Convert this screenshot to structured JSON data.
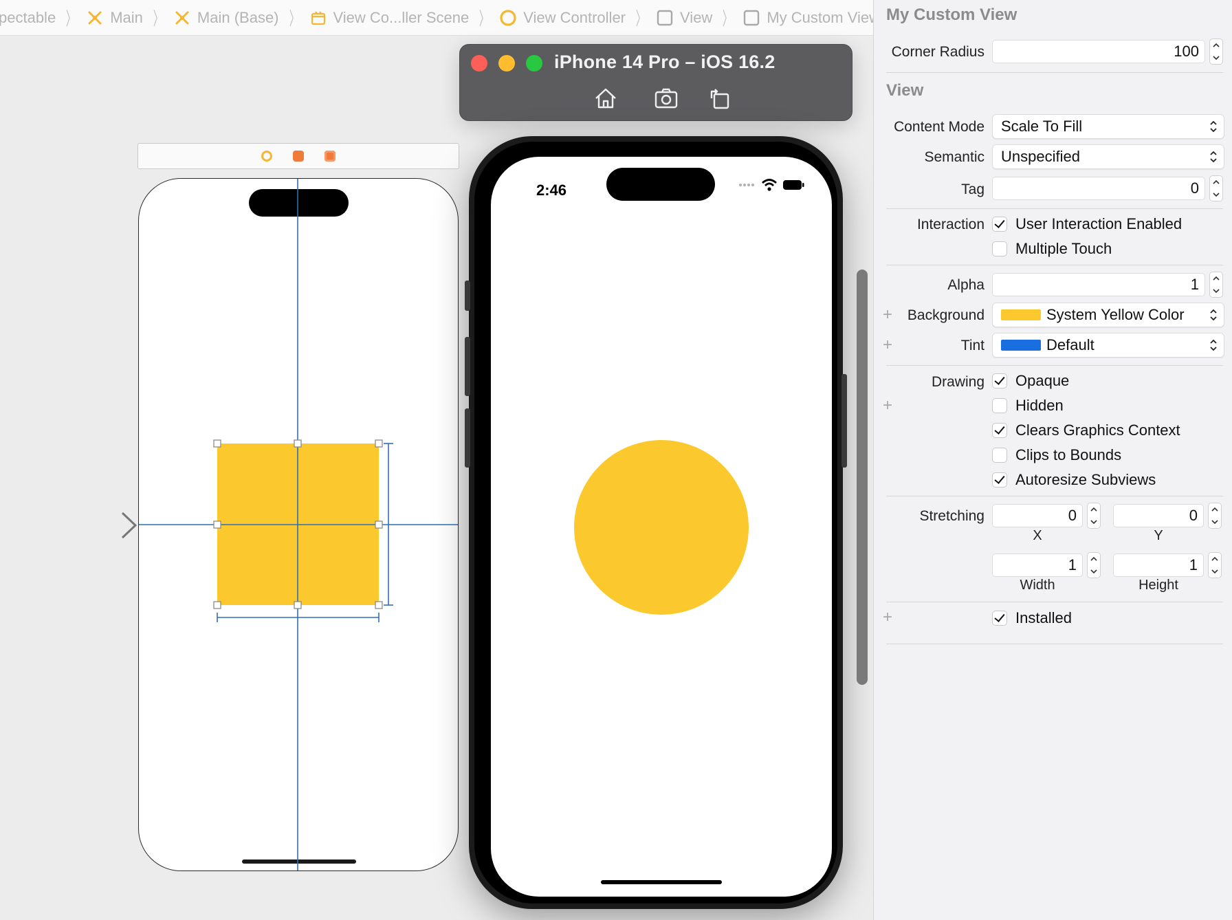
{
  "breadcrumb": [
    {
      "label": "pectable",
      "icon": "none"
    },
    {
      "label": "Main",
      "icon": "storyboard-icon"
    },
    {
      "label": "Main (Base)",
      "icon": "storyboard-icon"
    },
    {
      "label": "View Co...ller Scene",
      "icon": "scene-icon"
    },
    {
      "label": "View Controller",
      "icon": "view-controller-icon"
    },
    {
      "label": "View",
      "icon": "view-icon"
    },
    {
      "label": "My Custom View",
      "icon": "view-icon"
    }
  ],
  "simulator": {
    "title": "iPhone 14 Pro – iOS 16.2",
    "time": "2:46",
    "traffic_colors": {
      "close": "#fe5f57",
      "minimize": "#febc2e",
      "zoom": "#28c840"
    }
  },
  "colors": {
    "accent_blue": "#2f6fb3",
    "yellow": "#fbc92d",
    "tint_blue": "#1a6fe0"
  },
  "inspector": {
    "custom_section": {
      "title": "My Custom View",
      "corner_radius_label": "Corner Radius",
      "corner_radius_value": "100"
    },
    "view_section": {
      "title": "View",
      "content_mode_label": "Content Mode",
      "content_mode_value": "Scale To Fill",
      "semantic_label": "Semantic",
      "semantic_value": "Unspecified",
      "tag_label": "Tag",
      "tag_value": "0",
      "interaction_label": "Interaction",
      "user_interaction": {
        "label": "User Interaction Enabled",
        "checked": true
      },
      "multiple_touch": {
        "label": "Multiple Touch",
        "checked": false
      },
      "alpha_label": "Alpha",
      "alpha_value": "1",
      "background_label": "Background",
      "background_value": "System Yellow Color",
      "background_swatch": "#fbc92d",
      "tint_label": "Tint",
      "tint_value": "Default",
      "tint_swatch": "#1a6fe0",
      "drawing_label": "Drawing",
      "opaque": {
        "label": "Opaque",
        "checked": true
      },
      "hidden": {
        "label": "Hidden",
        "checked": false
      },
      "clears_context": {
        "label": "Clears Graphics Context",
        "checked": true
      },
      "clips_bounds": {
        "label": "Clips to Bounds",
        "checked": false
      },
      "autoresize": {
        "label": "Autoresize Subviews",
        "checked": true
      },
      "stretching_label": "Stretching",
      "stretch_x": "0",
      "stretch_y": "0",
      "stretch_w": "1",
      "stretch_h": "1",
      "x_label": "X",
      "y_label": "Y",
      "width_label": "Width",
      "height_label": "Height",
      "installed": {
        "label": "Installed",
        "checked": true
      }
    }
  }
}
